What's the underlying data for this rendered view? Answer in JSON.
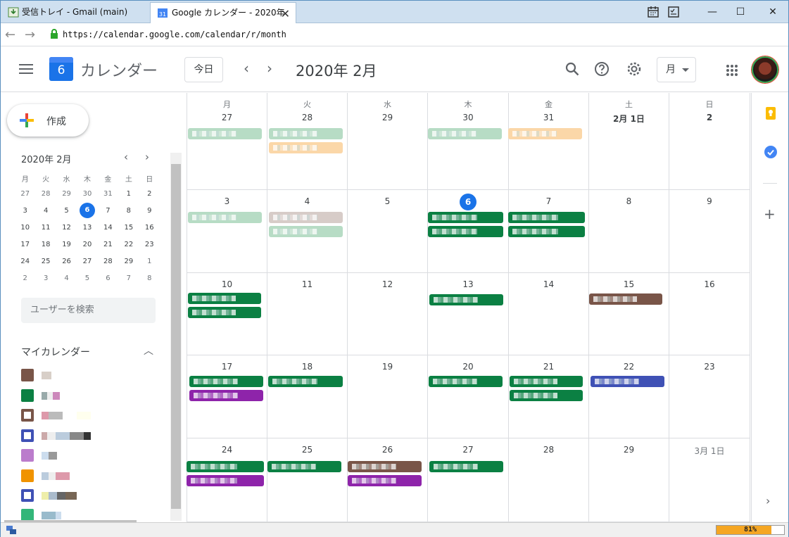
{
  "browser": {
    "tabs": [
      {
        "label": "受信トレイ - Gmail (main)"
      },
      {
        "label": "Google カレンダー - 2020年"
      }
    ],
    "url": "https://calendar.google.com/calendar/r/month",
    "zoom": "81%",
    "zoom_fraction": 0.81
  },
  "header": {
    "app_title": "カレンダー",
    "logo_day": "6",
    "today_button": "今日",
    "month_title": "2020年 2月",
    "view_select": "月"
  },
  "sidebar": {
    "create_label": "作成",
    "mini_title": "2020年 2月",
    "weekday_headers": [
      "月",
      "火",
      "水",
      "木",
      "金",
      "土",
      "日"
    ],
    "mini_weeks": [
      [
        "27",
        "28",
        "29",
        "30",
        "31",
        "1",
        "2"
      ],
      [
        "3",
        "4",
        "5",
        "6",
        "7",
        "8",
        "9"
      ],
      [
        "10",
        "11",
        "12",
        "13",
        "14",
        "15",
        "16"
      ],
      [
        "17",
        "18",
        "19",
        "20",
        "21",
        "22",
        "23"
      ],
      [
        "24",
        "25",
        "26",
        "27",
        "28",
        "29",
        "1"
      ],
      [
        "2",
        "3",
        "4",
        "5",
        "6",
        "7",
        "8"
      ]
    ],
    "search_placeholder": "ユーザーを検索",
    "my_calendars_label": "マイカレンダー",
    "calendar_colors": [
      "#795548",
      "#0b8043",
      "#795548",
      "#3f51b5",
      "#8e24aa",
      "#f09300",
      "#3f51b5",
      "#33b679"
    ]
  },
  "grid": {
    "weekday_headers": [
      "月",
      "火",
      "水",
      "木",
      "金",
      "土",
      "日"
    ],
    "weeks": [
      [
        "27",
        "28",
        "29",
        "30",
        "31",
        "2月 1日",
        "2"
      ],
      [
        "3",
        "4",
        "5",
        "6",
        "7",
        "8",
        "9"
      ],
      [
        "10",
        "11",
        "12",
        "13",
        "14",
        "15",
        "16"
      ],
      [
        "17",
        "18",
        "19",
        "20",
        "21",
        "22",
        "23"
      ],
      [
        "24",
        "25",
        "26",
        "27",
        "28",
        "29",
        "3月 1日"
      ]
    ]
  },
  "colors": {
    "accent": "#1a73e8",
    "green": "#0b8043",
    "light_green": "#b7dcc5",
    "peach": "#fbd7a8",
    "brown": "#795548",
    "purple": "#8e24aa",
    "indigo": "#3f51b5"
  }
}
